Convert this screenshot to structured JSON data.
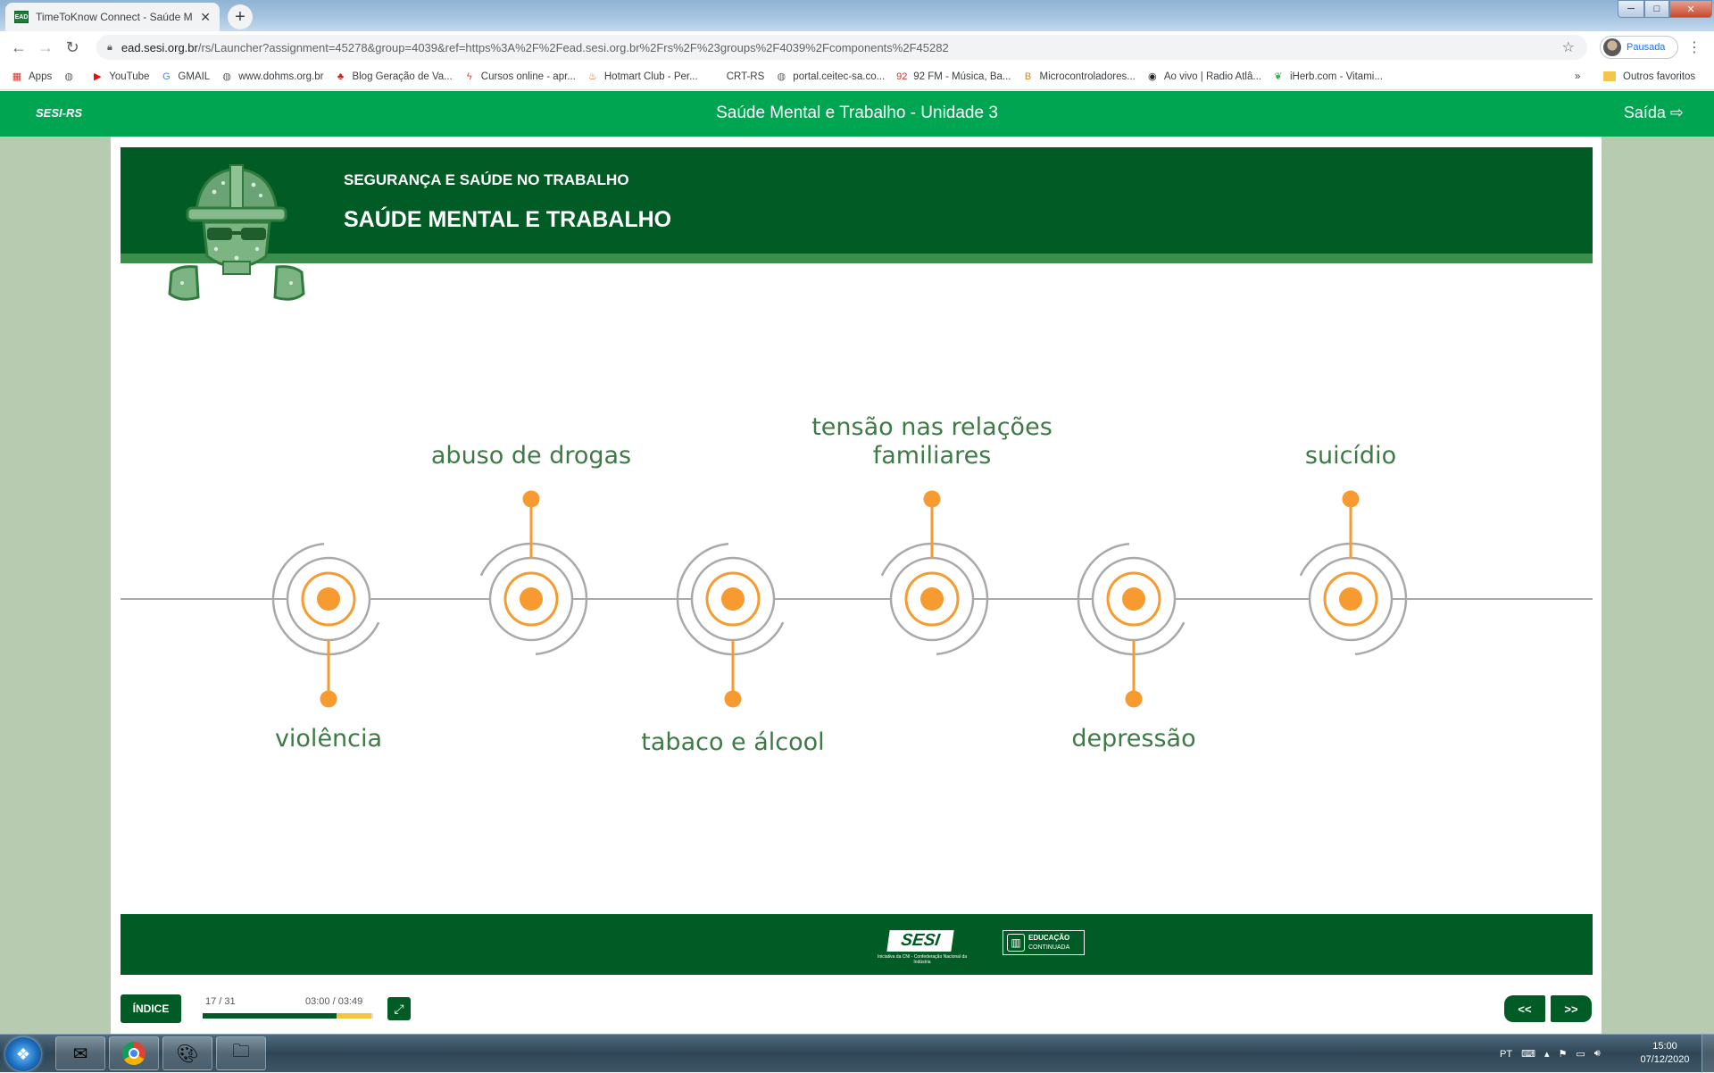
{
  "browser": {
    "tab": {
      "favicon": "EAD",
      "title": "TimeToKnow Connect - Saúde M",
      "close": "✕"
    },
    "new_tab": "+",
    "url": {
      "host": "ead.sesi.org.br",
      "path": "/rs/Launcher?assignment=45278&group=4039&ref=https%3A%2F%2Fead.sesi.org.br%2Frs%2F%23groups%2F4039%2Fcomponents%2F45282"
    },
    "profile_label": "Pausada",
    "bookmarks": [
      {
        "label": "Apps",
        "icon": "apps-grid-icon",
        "glyph": "▦",
        "color": "#d93025"
      },
      {
        "label": "",
        "icon": "globe-icon",
        "glyph": "◍",
        "color": "#5f6368"
      },
      {
        "label": "YouTube",
        "icon": "youtube-icon",
        "glyph": "▶",
        "color": "#ff0000"
      },
      {
        "label": "GMAIL",
        "icon": "google-icon",
        "glyph": "G",
        "color": "#4285f4"
      },
      {
        "label": "www.dohms.org.br",
        "icon": "globe-icon",
        "glyph": "◍",
        "color": "#5f6368"
      },
      {
        "label": "Blog Geração de Va...",
        "icon": "blog-icon",
        "glyph": "♣",
        "color": "#c5221f"
      },
      {
        "label": "Cursos online - apr...",
        "icon": "hotmart-icon",
        "glyph": "ϟ",
        "color": "#e8453c"
      },
      {
        "label": "Hotmart Club - Per...",
        "icon": "flame-icon",
        "glyph": "♨",
        "color": "#f4511e"
      },
      {
        "label": "CRT-RS",
        "icon": "blank-icon",
        "glyph": " ",
        "color": "#5f6368"
      },
      {
        "label": "portal.ceitec-sa.co...",
        "icon": "globe-icon",
        "glyph": "◍",
        "color": "#5f6368"
      },
      {
        "label": "92 FM - Música, Ba...",
        "icon": "radio-92-icon",
        "glyph": "92",
        "color": "#d93025"
      },
      {
        "label": "Microcontroladores...",
        "icon": "blogger-icon",
        "glyph": "B",
        "color": "#f57c00"
      },
      {
        "label": "Ao vivo | Radio Atlâ...",
        "icon": "radio-icon",
        "glyph": "◉",
        "color": "#202124"
      },
      {
        "label": "iHerb.com - Vitami...",
        "icon": "leaf-icon",
        "glyph": "❦",
        "color": "#34a853"
      }
    ],
    "bookmarks_more": "»",
    "other_bookmarks": "Outros favoritos"
  },
  "app": {
    "brand": "SESI-RS",
    "course_title": "Saúde Mental e Trabalho - Unidade 3",
    "exit_label": "Saída ⇨"
  },
  "slide": {
    "kicker": "SEGURANÇA E SAÚDE NO TRABALHO",
    "title": "SAÚDE MENTAL E TRABALHO",
    "timeline_items": [
      {
        "label_lines": [
          "violência"
        ],
        "position": "below"
      },
      {
        "label_lines": [
          "abuso de drogas"
        ],
        "position": "above"
      },
      {
        "label_lines": [
          "tabaco e álcool"
        ],
        "position": "below"
      },
      {
        "label_lines": [
          "tensão nas relações",
          "familiares"
        ],
        "position": "above"
      },
      {
        "label_lines": [
          "depressão"
        ],
        "position": "below"
      },
      {
        "label_lines": [
          "suicídio"
        ],
        "position": "above"
      }
    ],
    "colors": {
      "header": "#005b25",
      "accent_orange": "#f79a2f",
      "line_gray": "#a9a9a9",
      "label_green": "#3e7a46"
    },
    "footer": {
      "sesi_logo": "SESI",
      "sesi_tagline": "Iniciativa da CNI - Confederação Nacional da Indústria",
      "edu_logo_line1": "EDUCAÇÃO",
      "edu_logo_line2": "CONTINUADA"
    }
  },
  "player": {
    "index_label": "ÍNDICE",
    "page": "17 / 31",
    "time": "03:00 / 03:49",
    "progress_fraction": 0.786,
    "buffered_fraction": 1.0,
    "prev_label": "<<",
    "next_label": ">>"
  },
  "taskbar": {
    "language": "PT",
    "time": "15:00",
    "date": "07/12/2020"
  }
}
